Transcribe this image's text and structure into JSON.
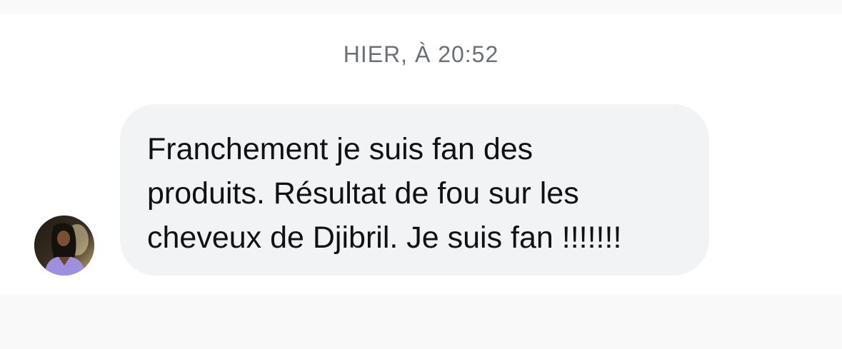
{
  "conversation": {
    "timestamp": "HIER, À 20:52",
    "message": {
      "text": "Franchement je suis fan des produits. Résultat de fou sur les cheveux de Djibril. Je suis fan !!!!!!!",
      "lines": [
        "Franchement je suis fan des",
        "produits. Résultat de fou sur les",
        "cheveux de Djibril. Je suis fan !!!!!!!"
      ],
      "sender_avatar_icon": "user-avatar-photo"
    }
  },
  "colors": {
    "page_background": "#f9f9f9",
    "chat_background": "#ffffff",
    "bubble_background": "#f2f3f5",
    "timestamp_text": "#6b6f76",
    "message_text": "#111111"
  }
}
